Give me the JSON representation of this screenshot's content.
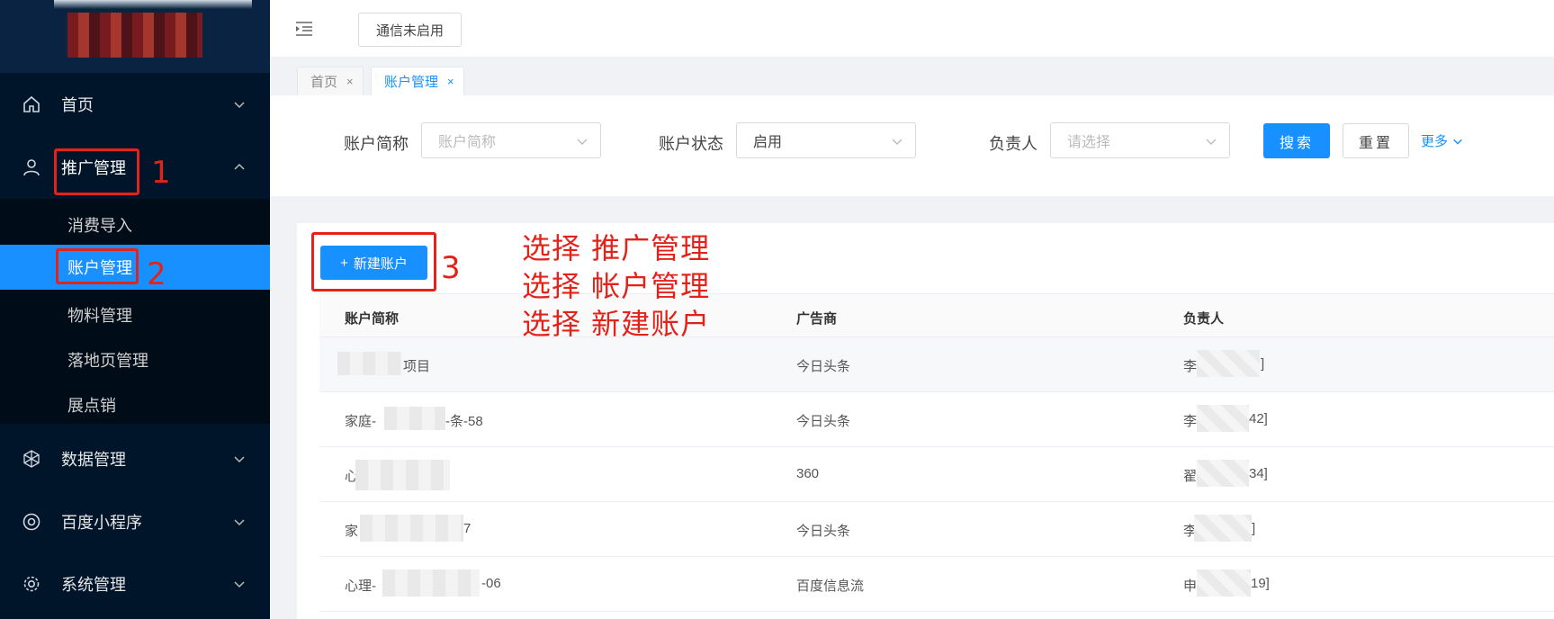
{
  "sidebar": {
    "menu": [
      {
        "label": "首页",
        "icon": "home-icon"
      },
      {
        "label": "推广管理",
        "icon": "user-icon"
      },
      {
        "label": "数据管理",
        "icon": "cube-icon"
      },
      {
        "label": "百度小程序",
        "icon": "target-icon"
      },
      {
        "label": "系统管理",
        "icon": "gear-icon"
      }
    ],
    "submenu": [
      "消费导入",
      "账户管理",
      "物料管理",
      "落地页管理",
      "展点销"
    ]
  },
  "header": {
    "comm_status": "通信未启用"
  },
  "tabs": [
    {
      "label": "首页",
      "close": "×"
    },
    {
      "label": "账户管理",
      "close": "×"
    }
  ],
  "search": {
    "account_label": "账户简称",
    "account_placeholder": "账户简称",
    "status_label": "账户状态",
    "status_value": "启用",
    "owner_label": "负责人",
    "owner_placeholder": "请选择",
    "search_btn": "搜索",
    "reset_btn": "重置",
    "more_link": "更多"
  },
  "toolbar": {
    "new_account_btn": "新建账户",
    "plus": "+"
  },
  "table": {
    "headers": [
      "账户简称",
      "广告商",
      "负责人"
    ],
    "rows": [
      [
        "项目",
        "今日头条",
        "李"
      ],
      [
        "家庭-",
        "今日头条",
        "李"
      ],
      [
        "心",
        "360",
        "翟"
      ],
      [
        "家",
        "今日头条",
        "李"
      ],
      [
        "心理-",
        "百度信息流",
        "申"
      ]
    ],
    "row_suffixes": [
      [
        "",
        "",
        "]"
      ],
      [
        "-条-58",
        "",
        "42]"
      ],
      [
        "",
        "",
        "34]"
      ],
      [
        "7",
        "",
        "]"
      ],
      [
        "-06",
        "",
        "19]"
      ]
    ]
  },
  "annotations": {
    "num1": "1",
    "num2": "2",
    "num3": "3",
    "notes": [
      "选择 推广管理",
      "选择 帐户管理",
      "选择 新建账户"
    ],
    "color": "#e3231a"
  },
  "colors": {
    "primary": "#1890ff",
    "sidebar": "#001529"
  }
}
